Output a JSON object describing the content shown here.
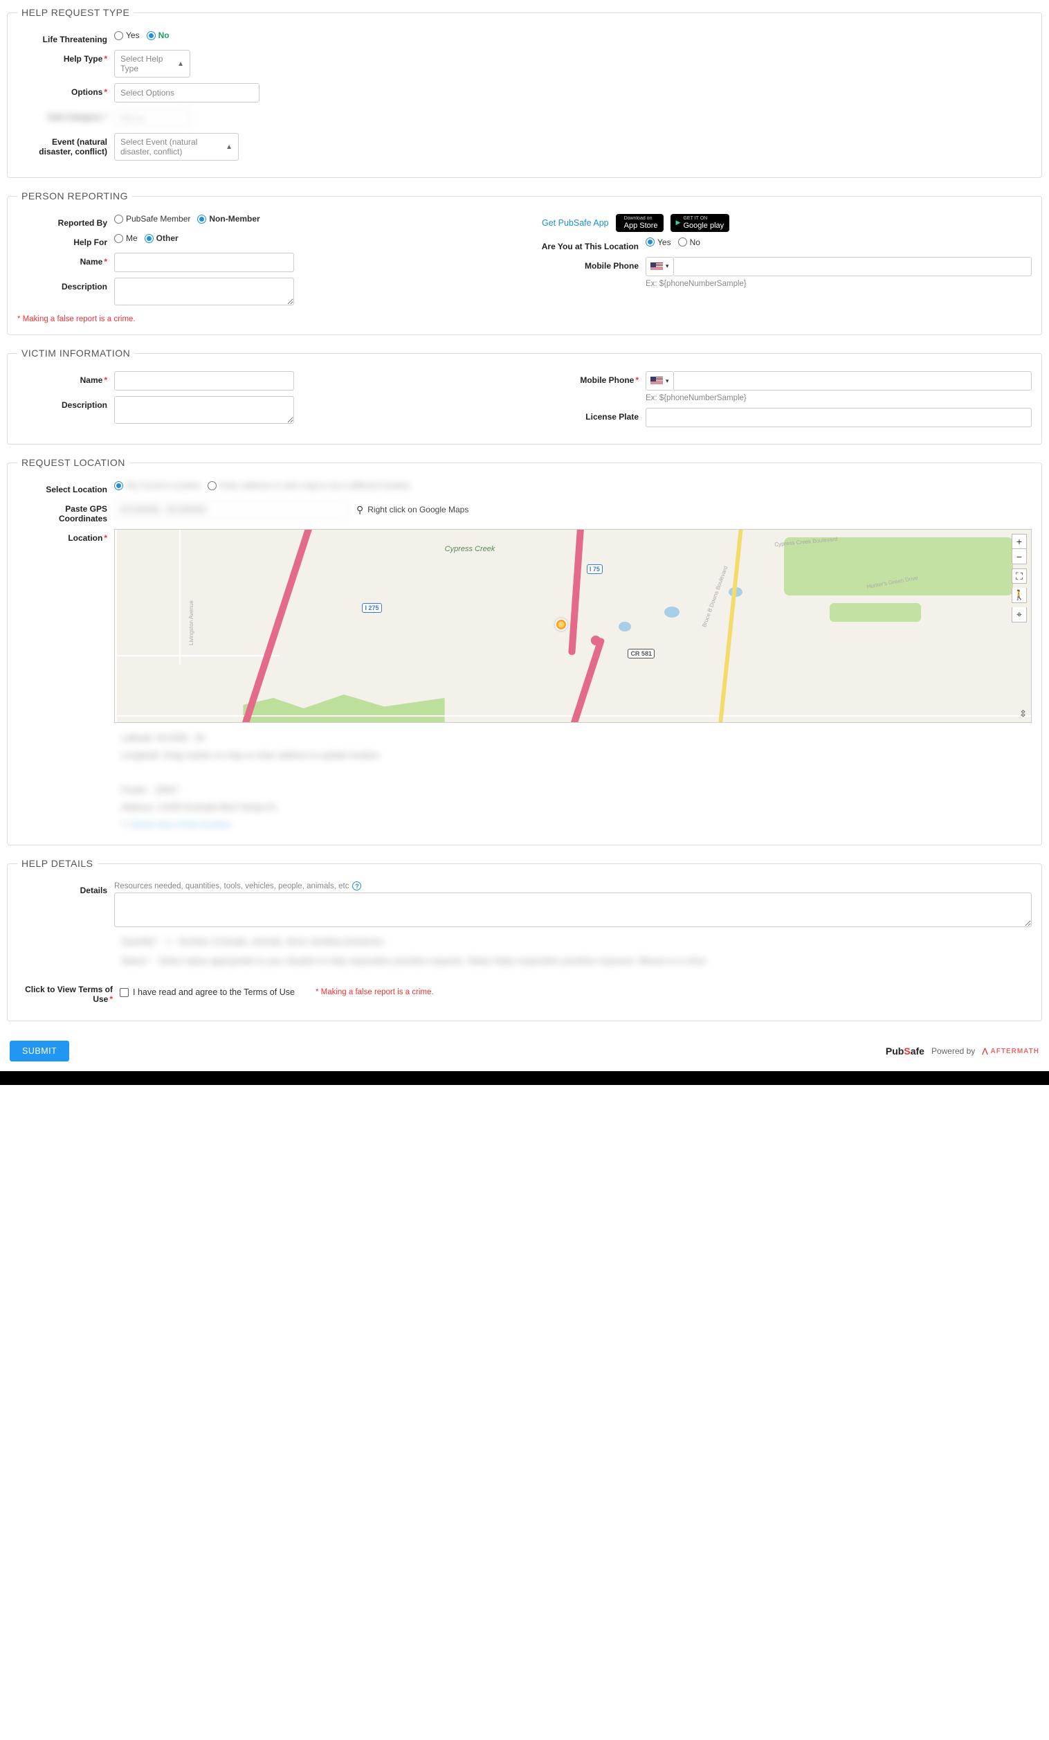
{
  "sections": {
    "help_request_type": "HELP REQUEST TYPE",
    "person_reporting": "PERSON REPORTING",
    "victim_info": "VICTIM INFORMATION",
    "request_location": "REQUEST LOCATION",
    "help_details": "HELP DETAILS"
  },
  "labels": {
    "life_threatening": "Life Threatening",
    "help_type": "Help Type",
    "options": "Options",
    "event": "Event (natural disaster, conflict)",
    "reported_by": "Reported By",
    "help_for": "Help For",
    "name": "Name",
    "description": "Description",
    "mobile_phone": "Mobile Phone",
    "are_you_at_location": "Are You at This Location",
    "license_plate": "License Plate",
    "select_location": "Select Location",
    "paste_gps": "Paste GPS Coordinates",
    "location": "Location",
    "details": "Details",
    "terms": "Click to View Terms of Use"
  },
  "radios": {
    "yes": "Yes",
    "no": "No",
    "pubsafe_member": "PubSafe Member",
    "non_member": "Non-Member",
    "me": "Me",
    "other": "Other"
  },
  "placeholders": {
    "help_type": "Select Help Type",
    "options": "Select Options",
    "event": "Select Event (natural disaster, conflict)",
    "details": "Resources needed, quantities, tools, vehicles, people, animals, etc"
  },
  "hints": {
    "phone_example": "Ex: ${phoneNumberSample}",
    "gps_right_click": "Right click on Google Maps"
  },
  "warnings": {
    "false_report": "* Making a false report is a crime."
  },
  "links": {
    "get_app": "Get PubSafe App"
  },
  "badges": {
    "app_store": "App Store",
    "google_play": "Google play"
  },
  "terms_checkbox": "I have read and agree to the Terms of Use",
  "submit": "SUBMIT",
  "footer": {
    "powered_by": "Powered by",
    "pubsafe": "PubSafe",
    "aftermath": "AFTERMATH"
  },
  "map": {
    "area_label": "Cypress Creek",
    "shield_i275": "I 275",
    "shield_i75": "I 75",
    "shield_cr581": "CR 581",
    "street_livingston": "Livingston Avenue",
    "street_bruce": "Bruce B Downs Boulevard",
    "street_hunters": "Hunter's Green Drive",
    "street_cypress_creek": "Cypress Creek Boulevard"
  }
}
